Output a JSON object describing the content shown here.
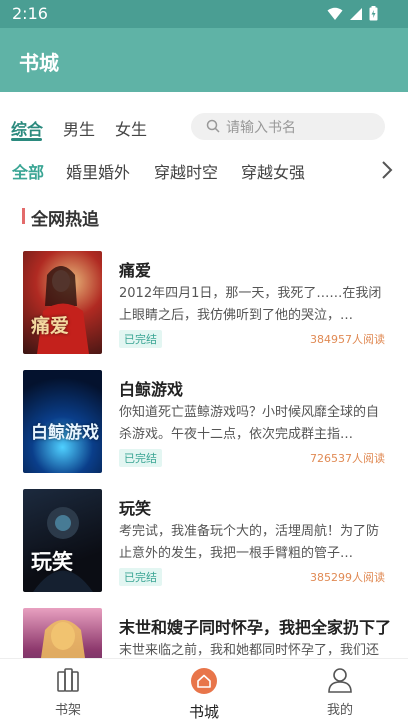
{
  "status": {
    "time": "2:16"
  },
  "app": {
    "title": "书城"
  },
  "gender_tabs": [
    {
      "label": "综合",
      "active": true
    },
    {
      "label": "男生",
      "active": false
    },
    {
      "label": "女生",
      "active": false
    }
  ],
  "search": {
    "placeholder": "请输入书名"
  },
  "categories": [
    {
      "label": "全部",
      "active": true
    },
    {
      "label": "婚里婚外",
      "active": false
    },
    {
      "label": "穿越时空",
      "active": false
    },
    {
      "label": "穿越女强",
      "active": false
    }
  ],
  "section": {
    "title": "全网热追"
  },
  "books": [
    {
      "title": "痛爱",
      "desc": "2012年四月1日，那一天，我死了……在我闭上眼睛之后，我仿佛听到了他的哭泣，…",
      "status": "已完结",
      "reads": "384957人阅读",
      "cover_text": "痛爱",
      "cover_colors": [
        "#3a1412",
        "#b02a22",
        "#e8b77a"
      ]
    },
    {
      "title": "白鲸游戏",
      "desc": "你知道死亡蓝鲸游戏吗？小时候风靡全球的自杀游戏。午夜十二点，依次完成群主指…",
      "status": "已完结",
      "reads": "726537人阅读",
      "cover_text": "白鲸游戏",
      "cover_colors": [
        "#04122e",
        "#0a3e8a",
        "#4fd0ff"
      ]
    },
    {
      "title": "玩笑",
      "desc": "考完试，我准备玩个大的，活埋周航！为了防止意外的发生，我把一根手臂粗的管子…",
      "status": "已完结",
      "reads": "385299人阅读",
      "cover_text": "玩笑",
      "cover_colors": [
        "#0b0d14",
        "#1c2a3e",
        "#5aa7c8"
      ]
    },
    {
      "title": "末世和嫂子同时怀孕，我把全家扔下了",
      "desc": "末世来临之前，我和她都同时怀孕了，我们还在…",
      "status": "",
      "reads": "",
      "cover_text": "",
      "cover_colors": [
        "#2a2450",
        "#8e3a6e",
        "#e8a0c0"
      ]
    }
  ],
  "bottom_nav": [
    {
      "label": "书架",
      "icon": "bookshelf-icon",
      "active": false
    },
    {
      "label": "书城",
      "icon": "home-icon",
      "active": true
    },
    {
      "label": "我的",
      "icon": "user-icon",
      "active": false
    }
  ],
  "colors": {
    "primary": "#5fb3a6",
    "status_bar": "#4a9e93",
    "accent": "#3aa594",
    "reads": "#e08a54",
    "section_marker": "#e36b6b"
  }
}
